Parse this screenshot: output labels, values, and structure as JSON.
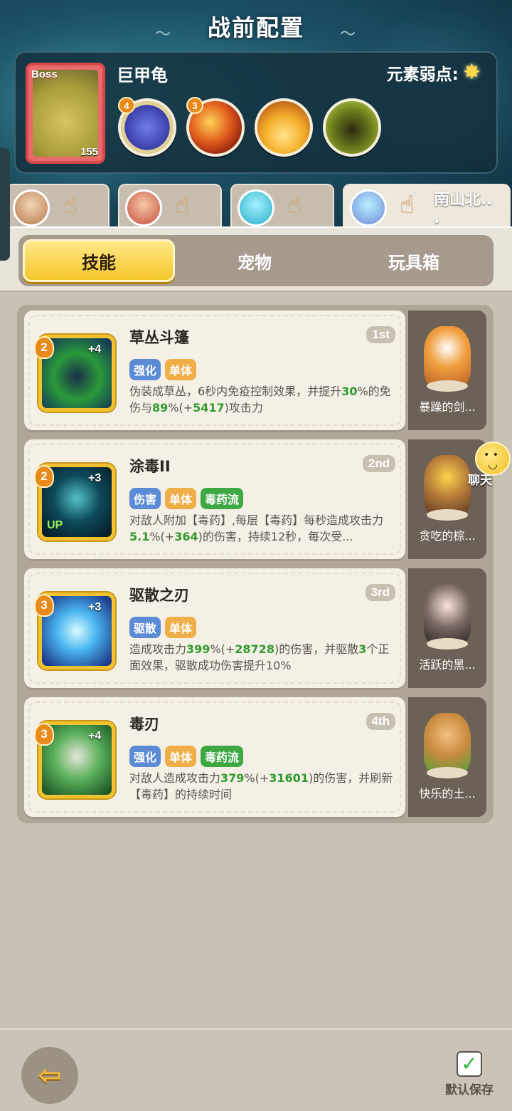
{
  "header": {
    "title": "战前配置"
  },
  "boss": {
    "tag": "Boss",
    "level": "155",
    "name": "巨甲龟",
    "weakness_label": "元素弱点:",
    "weakness_icon": "star-icon",
    "skills": [
      {
        "level": "4",
        "icon": "swirl-icon"
      },
      {
        "level": "3",
        "icon": "fire-wave-icon"
      },
      {
        "level": "",
        "icon": "crown-spike-icon"
      },
      {
        "level": "",
        "icon": "shadow-beast-icon"
      }
    ]
  },
  "team": [
    {
      "name": "",
      "icon": "hand-icon"
    },
    {
      "name": "",
      "icon": "hand-icon"
    },
    {
      "name": "",
      "icon": "hand-icon"
    },
    {
      "name": "南山北..\n.",
      "icon": "hand-icon"
    }
  ],
  "tabs": {
    "skills": "技能",
    "pets": "宠物",
    "toybox": "玩具箱"
  },
  "skills": [
    {
      "level": "2",
      "plus": "+4",
      "up": "",
      "name": "草丛斗篷",
      "rank": "1st",
      "tags": [
        "强化",
        "单体"
      ],
      "desc_a": "伪装成草丛，6秒内免疫控制效果，并提升",
      "desc_h1": "30",
      "desc_b": "%的免伤与",
      "desc_h2": "89",
      "desc_c": "%(+",
      "desc_h3": "5417",
      "desc_d": ")攻击力"
    },
    {
      "level": "2",
      "plus": "+3",
      "up": "UP",
      "name": "涂毒II",
      "rank": "2nd",
      "tags": [
        "伤害",
        "单体",
        "毒药流"
      ],
      "desc_a": "对敌人附加【毒药】,每层【毒药】每秒造成攻击力",
      "desc_h1": "5.1",
      "desc_b": "%(+",
      "desc_h2": "364",
      "desc_c": ")的伤害，持续12秒，每次受...",
      "desc_h3": "",
      "desc_d": ""
    },
    {
      "level": "3",
      "plus": "+3",
      "up": "",
      "name": "驱散之刃",
      "rank": "3rd",
      "tags": [
        "驱散",
        "单体"
      ],
      "desc_a": "造成攻击力",
      "desc_h1": "399",
      "desc_b": "%(+",
      "desc_h2": "28728",
      "desc_c": ")的伤害，并驱散",
      "desc_h3": "3",
      "desc_d": "个正面效果，驱散成功伤害提升10%"
    },
    {
      "level": "3",
      "plus": "+4",
      "up": "",
      "name": "毒刃",
      "rank": "4th",
      "tags": [
        "强化",
        "单体",
        "毒药流"
      ],
      "desc_a": "对敌人造成攻击力",
      "desc_h1": "379",
      "desc_b": "%(+",
      "desc_h2": "31601",
      "desc_c": ")的伤害，并刷新【毒药】的持续时间",
      "desc_h3": "",
      "desc_d": ""
    }
  ],
  "pets": [
    {
      "name": "暴躁的剑..."
    },
    {
      "name": "贪吃的棕..."
    },
    {
      "name": "活跃的黑..."
    },
    {
      "name": "快乐的土..."
    }
  ],
  "chat": {
    "label": "聊天"
  },
  "footer": {
    "back_icon": "arrow-left-icon",
    "save_label": "默认保存",
    "save_icon": "check-icon"
  },
  "colors": {
    "highlight": "#2f9a2c",
    "gold": "#f6c72c",
    "boss_red": "#d94848"
  }
}
